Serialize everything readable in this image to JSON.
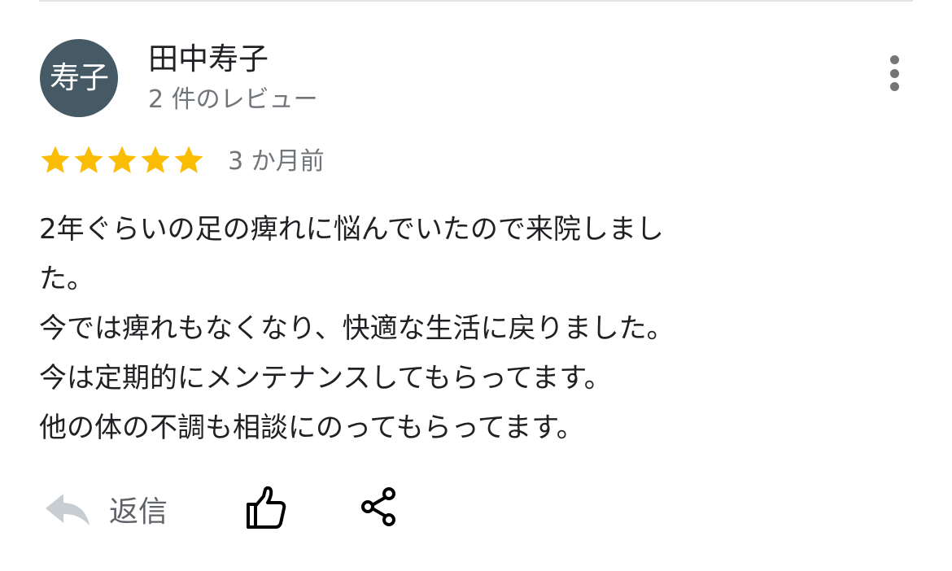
{
  "review": {
    "avatar_text": "寿子",
    "reviewer_name": "田中寿子",
    "review_count": "2 件のレビュー",
    "rating": 5,
    "rating_max": 5,
    "date": "3 か月前",
    "text_lines": [
      "2年ぐらいの足の痺れに悩んでいたので来院しまし",
      "た。",
      "今では痺れもなくなり、快適な生活に戻りました。",
      "今は定期的にメンテナンスしてもらってます。",
      "他の体の不調も相談にのってもらってます。"
    ]
  },
  "actions": {
    "reply_label": "返信"
  },
  "colors": {
    "avatar_bg": "#455a64",
    "star": "#fbbc04",
    "secondary_text": "#70757a"
  },
  "icons": [
    "more-vert-icon",
    "star-icon",
    "reply-icon",
    "thumb-up-icon",
    "share-icon"
  ]
}
